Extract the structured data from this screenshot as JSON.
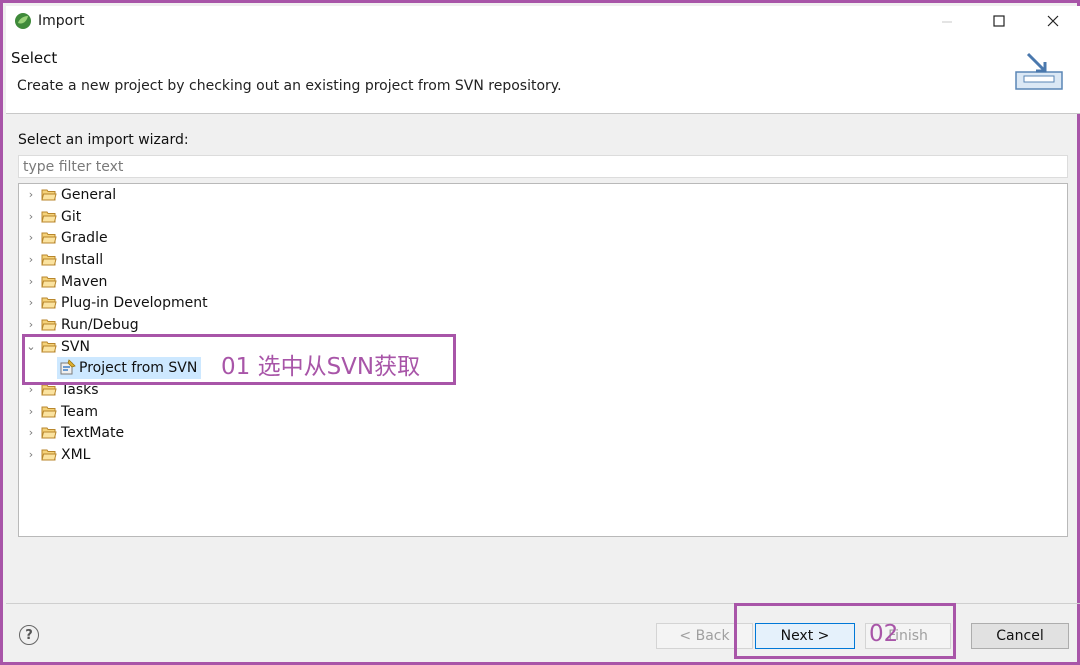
{
  "window": {
    "title": "Import"
  },
  "header": {
    "title": "Select",
    "description": "Create a new project by checking out an existing project from SVN repository."
  },
  "wizard": {
    "label": "Select an import wizard:",
    "filter_placeholder": "type filter text",
    "items": [
      {
        "label": "General",
        "expanded": false
      },
      {
        "label": "Git",
        "expanded": false
      },
      {
        "label": "Gradle",
        "expanded": false
      },
      {
        "label": "Install",
        "expanded": false
      },
      {
        "label": "Maven",
        "expanded": false
      },
      {
        "label": "Plug-in Development",
        "expanded": false
      },
      {
        "label": "Run/Debug",
        "expanded": false
      },
      {
        "label": "SVN",
        "expanded": true,
        "children": [
          {
            "label": "Project from SVN",
            "selected": true
          }
        ]
      },
      {
        "label": "Tasks",
        "expanded": false
      },
      {
        "label": "Team",
        "expanded": false
      },
      {
        "label": "TextMate",
        "expanded": false
      },
      {
        "label": "XML",
        "expanded": false
      }
    ]
  },
  "annotations": {
    "step1": "01 选中从SVN获取",
    "step2": "02"
  },
  "footer": {
    "help": "?",
    "back_label": "< Back",
    "next_label": "Next >",
    "finish_label": "Finish",
    "cancel_label": "Cancel"
  },
  "colors": {
    "annotation": "#a855a8",
    "selection": "#cde8ff",
    "folder": "#e8b64c",
    "default_button_border": "#0078d7"
  }
}
